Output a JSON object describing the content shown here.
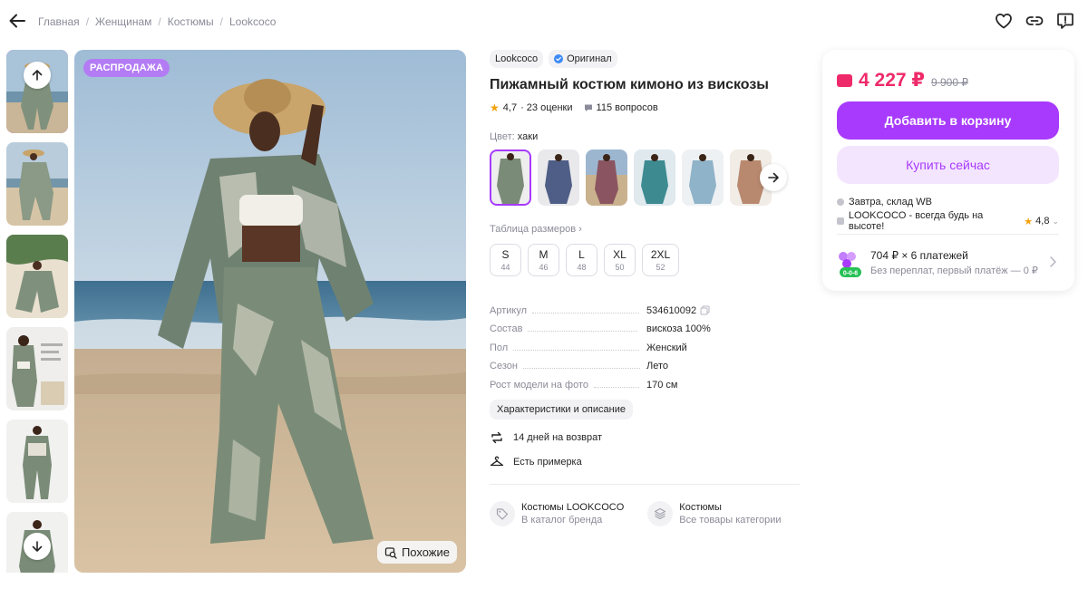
{
  "breadcrumbs": [
    "Главная",
    "Женщинам",
    "Костюмы",
    "Lookcoco"
  ],
  "top_icons": [
    "heart-icon",
    "link-icon",
    "report-icon"
  ],
  "gallery": {
    "badge": "РАСПРОДАЖА",
    "similar_label": "Похожие",
    "thumb_count": 6
  },
  "product": {
    "brand": "Lookcoco",
    "original_label": "Оригинал",
    "title": "Пижамный костюм кимоно из вискозы",
    "rating": "4,7",
    "reviews": "· 23 оценки",
    "questions": "115 вопросов",
    "color_label": "Цвет:",
    "color_value": "хаки",
    "size_table_label": "Таблица размеров",
    "sizes": [
      {
        "name": "S",
        "ru": "44"
      },
      {
        "name": "M",
        "ru": "46"
      },
      {
        "name": "L",
        "ru": "48"
      },
      {
        "name": "XL",
        "ru": "50"
      },
      {
        "name": "2XL",
        "ru": "52"
      }
    ],
    "specs": [
      {
        "key": "Артикул",
        "value": "534610092"
      },
      {
        "key": "Состав",
        "value": "вискоза 100%"
      },
      {
        "key": "Пол",
        "value": "Женский"
      },
      {
        "key": "Сезон",
        "value": "Лето"
      },
      {
        "key": "Рост модели на фото",
        "value": "170 см"
      }
    ],
    "description_button": "Характеристики и описание",
    "features": [
      "14 дней на возврат",
      "Есть примерка"
    ],
    "links": [
      {
        "title": "Костюмы LOOKCOCO",
        "subtitle": "В каталог бренда"
      },
      {
        "title": "Костюмы",
        "subtitle": "Все товары категории"
      }
    ]
  },
  "buy": {
    "price": "4 227 ₽",
    "old_price": "9 900 ₽",
    "add_to_cart": "Добавить в корзину",
    "buy_now": "Купить сейчас",
    "delivery": "Завтра, склад WB",
    "seller": "LOOKCOCO - всегда будь на высоте!",
    "seller_rating": "4,8",
    "installment_title": "704 ₽ × 6 платежей",
    "installment_sub": "Без переплат, первый платёж — 0 ₽",
    "installment_badge": "0-0-6"
  },
  "colors": {
    "accent": "#a73afd",
    "accent_light": "#f4e5ff",
    "price": "#ee2a6a",
    "badge": "#b37cf5"
  }
}
